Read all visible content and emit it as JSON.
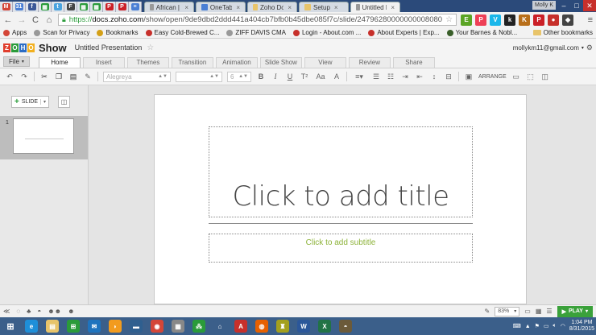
{
  "browser": {
    "pinned_tabs": [
      {
        "icon": "gmail-icon",
        "glyph": "M",
        "color": "#d44638"
      },
      {
        "icon": "calendar-icon",
        "glyph": "31",
        "color": "#4a7fd4"
      },
      {
        "icon": "facebook-icon",
        "glyph": "f",
        "color": "#3b5998"
      },
      {
        "icon": "sheets-icon",
        "glyph": "▦",
        "color": "#2a9b3a"
      },
      {
        "icon": "twitter-icon",
        "glyph": "t",
        "color": "#4aa3df"
      },
      {
        "icon": "feedly-icon",
        "glyph": "F",
        "color": "#444444"
      },
      {
        "icon": "sheets-icon",
        "glyph": "▦",
        "color": "#2a9b3a"
      },
      {
        "icon": "sheets-icon",
        "glyph": "▦",
        "color": "#2a9b3a"
      },
      {
        "icon": "pinterest-icon",
        "glyph": "P",
        "color": "#cb2027"
      },
      {
        "icon": "pinterest-icon",
        "glyph": "P",
        "color": "#cb2027"
      },
      {
        "icon": "docs-icon",
        "glyph": "≡",
        "color": "#4a7fd4"
      }
    ],
    "tabs": [
      {
        "label": "African | Good",
        "color": "#999999",
        "active": false
      },
      {
        "label": "OneTab",
        "color": "#4a7fd4",
        "active": false
      },
      {
        "label": "Zoho Docs",
        "color": "#e8c46a",
        "active": false
      },
      {
        "label": "Setup",
        "color": "#e8c46a",
        "active": false
      },
      {
        "label": "Untitled Presen",
        "color": "#999999",
        "active": true
      }
    ],
    "user_chip": "Molly K",
    "url_scheme": "https://",
    "url_host": "docs.zoho.com",
    "url_path": "/show/open/9de9dbd2ddd441a404cb7bfb0b45dbe085f7c/slide/24796280000000008080",
    "extensions": [
      {
        "icon": "evernote-icon",
        "glyph": "E",
        "color": "#5ba525"
      },
      {
        "icon": "pocket-icon",
        "glyph": "P",
        "color": "#ee4056"
      },
      {
        "icon": "vimeo-icon",
        "glyph": "V",
        "color": "#1ab7ea"
      },
      {
        "icon": "k-icon",
        "glyph": "k",
        "color": "#222222"
      },
      {
        "icon": "kindle-icon",
        "glyph": "K",
        "color": "#b86f1a"
      },
      {
        "icon": "pinterest-icon",
        "glyph": "P",
        "color": "#cb2027"
      },
      {
        "icon": "adblock-icon",
        "glyph": "●",
        "color": "#c7302b"
      },
      {
        "icon": "lastpass-icon",
        "glyph": "◆",
        "color": "#444444"
      }
    ],
    "bookmarks": [
      {
        "label": "Apps",
        "color": "#d44638"
      },
      {
        "label": "Scan for Privacy",
        "color": "#999999"
      },
      {
        "label": "Bookmarks",
        "color": "#d4a017"
      },
      {
        "label": "Easy Cold-Brewed C...",
        "color": "#c7302b"
      },
      {
        "label": "ZIFF DAVIS CMA",
        "color": "#999999"
      },
      {
        "label": "Login - About.com ...",
        "color": "#c7302b"
      },
      {
        "label": "About Experts | Exp...",
        "color": "#c7302b"
      },
      {
        "label": "Your Barnes & Nobl...",
        "color": "#3a5f2a"
      }
    ],
    "other_bookmarks": "Other bookmarks"
  },
  "app": {
    "logo_letters": [
      {
        "ch": "Z",
        "color": "#e03e2d"
      },
      {
        "ch": "O",
        "color": "#2a9b3a"
      },
      {
        "ch": "H",
        "color": "#2b6cc4"
      },
      {
        "ch": "O",
        "color": "#f2b01e"
      }
    ],
    "logo_product": "Show",
    "presentation_title": "Untitled Presentation",
    "account": "mollykm11@gmail.com",
    "file_menu": "File",
    "ribbon_tabs": [
      {
        "label": "Home",
        "active": true
      },
      {
        "label": "Insert",
        "active": false
      },
      {
        "label": "Themes",
        "active": false
      },
      {
        "label": "Transition",
        "active": false
      },
      {
        "label": "Animation",
        "active": false
      },
      {
        "label": "Slide Show",
        "active": false
      },
      {
        "label": "View",
        "active": false
      },
      {
        "label": "Review",
        "active": false
      },
      {
        "label": "Share",
        "active": false
      }
    ],
    "font_family_value": "Alegreya",
    "font_size_value": "6",
    "arrange_label": "ARRANGE"
  },
  "panel": {
    "add_slide_label": "SLIDE",
    "slide_number": "1"
  },
  "slide": {
    "title_placeholder": "Click to add title",
    "subtitle_placeholder": "Click to add subtitle"
  },
  "status": {
    "zoom": "83%",
    "play_label": "PLAY"
  },
  "taskbar": {
    "apps": [
      {
        "icon": "ie-icon",
        "glyph": "e",
        "color": "#1e8fd9"
      },
      {
        "icon": "file-explorer-icon",
        "glyph": "▤",
        "color": "#e8c46a"
      },
      {
        "icon": "store-icon",
        "glyph": "⊞",
        "color": "#2a9b3a"
      },
      {
        "icon": "mail-icon",
        "glyph": "✉",
        "color": "#1e73be"
      },
      {
        "icon": "audible-icon",
        "glyph": "◗",
        "color": "#f29b1e"
      },
      {
        "icon": "scanner-icon",
        "glyph": "▬",
        "color": "#2f5f8f"
      },
      {
        "icon": "chrome-icon",
        "glyph": "◉",
        "color": "#d44638"
      },
      {
        "icon": "apps-grid-icon",
        "glyph": "▦",
        "color": "#888888"
      },
      {
        "icon": "network-icon",
        "glyph": "⁂",
        "color": "#2a9b3a"
      },
      {
        "icon": "home-icon",
        "glyph": "⌂",
        "color": "#3b5f8a"
      },
      {
        "icon": "acrobat-icon",
        "glyph": "A",
        "color": "#c7302b"
      },
      {
        "icon": "firefox-icon",
        "glyph": "◍",
        "color": "#e66000"
      },
      {
        "icon": "onenote-icon",
        "glyph": "♜",
        "color": "#a3a01e"
      },
      {
        "icon": "word-icon",
        "glyph": "W",
        "color": "#2b579a"
      },
      {
        "icon": "excel-icon",
        "glyph": "X",
        "color": "#217346"
      },
      {
        "icon": "gimp-icon",
        "glyph": "◓",
        "color": "#6b5a3a"
      }
    ],
    "clock_time": "1:04 PM",
    "clock_date": "8/31/2015"
  }
}
